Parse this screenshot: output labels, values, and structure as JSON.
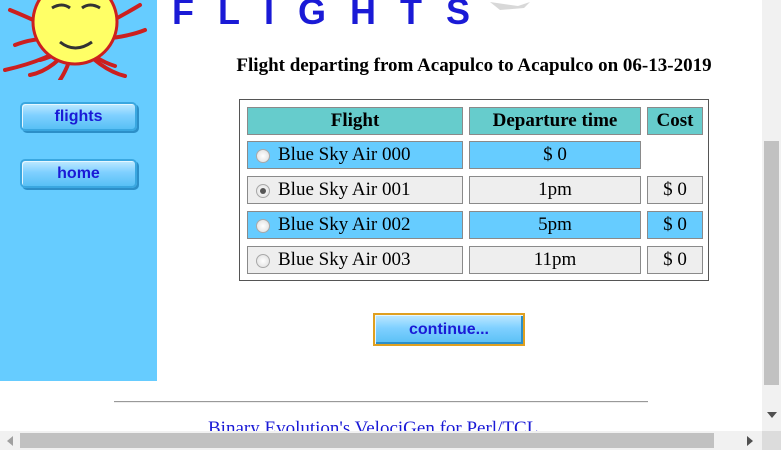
{
  "header": {
    "logo_text": "FLIGHTS"
  },
  "sidebar": {
    "flights_label": "flights",
    "home_label": "home"
  },
  "main": {
    "heading": "Flight departing from Acapulco to Acapulco on 06-13-2019",
    "table": {
      "columns": [
        "Flight",
        "Departure time",
        "Cost"
      ],
      "rows": [
        {
          "flight": "Blue Sky Air 000",
          "departure": "$ 0",
          "cost": "",
          "selected": false
        },
        {
          "flight": "Blue Sky Air 001",
          "departure": "1pm",
          "cost": "$ 0",
          "selected": true
        },
        {
          "flight": "Blue Sky Air 002",
          "departure": "5pm",
          "cost": "$ 0",
          "selected": false
        },
        {
          "flight": "Blue Sky Air 003",
          "departure": "11pm",
          "cost": "$ 0",
          "selected": false
        }
      ]
    },
    "continue_label": "continue..."
  },
  "footer": {
    "link_text": "Binary Evolution's VelociGen for Perl/TCL"
  },
  "colors": {
    "sidebar_bg": "#66ccff",
    "header_cell_bg": "#66cccc",
    "link_blue": "#1a1ad6",
    "row_alt_gray": "#eeeeee"
  }
}
